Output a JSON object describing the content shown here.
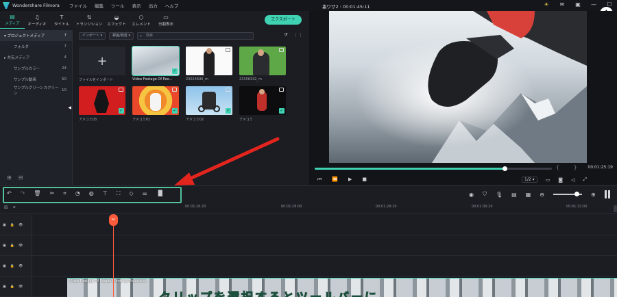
{
  "titlebar": {
    "app_name": "Wondershare Filmora",
    "menu": [
      "ファイル",
      "編集",
      "ツール",
      "表示",
      "出力",
      "ヘルプ"
    ],
    "doc_title": "裏ワザ2 : 00:01:45:11"
  },
  "media_tabs": [
    {
      "label": "メディア",
      "icon": "media-icon"
    },
    {
      "label": "オーディオ",
      "icon": "music-note-icon"
    },
    {
      "label": "タイトル",
      "icon": "text-t-icon"
    },
    {
      "label": "トランジション",
      "icon": "transition-icon"
    },
    {
      "label": "エフェクト",
      "icon": "effects-icon"
    },
    {
      "label": "エレメント",
      "icon": "elements-icon"
    },
    {
      "label": "分割表示",
      "icon": "split-screen-icon"
    }
  ],
  "export_label": "エクスポート",
  "sidebar": {
    "items": [
      {
        "label": "プロジェクトメディア",
        "count": "7"
      },
      {
        "label": "フォルダ",
        "count": "7"
      },
      {
        "label": "共有メディア",
        "count": "4"
      },
      {
        "label": "サンプルカラー",
        "count": "24"
      },
      {
        "label": "サンプル動画",
        "count": "50"
      },
      {
        "label": "サンプルグリーンスクリーン",
        "count": "10"
      }
    ]
  },
  "media_filters": {
    "import_label": "インポート",
    "record_label": "録画/録音",
    "search_placeholder": "検索"
  },
  "media_items": [
    {
      "caption": "ファイルをインポート"
    },
    {
      "caption": "Video Footage Of Peo..."
    },
    {
      "caption": "23024690_m"
    },
    {
      "caption": "23156332_m"
    },
    {
      "caption": "アメコミ03"
    },
    {
      "caption": "アメコミ01"
    },
    {
      "caption": "アメコミ02"
    },
    {
      "caption": "アメコミ"
    }
  ],
  "preview": {
    "progress": 0.8,
    "timecode": "00:01:25:19",
    "quality": "1/2"
  },
  "timeline": {
    "ruler_labels": [
      "00:01:26:20",
      "00:01:28:00",
      "00:01:29:10",
      "00:01:30:20",
      "00:01:32:00"
    ],
    "clip_title": "Video Footage Of People Climbing Mountains",
    "caption_overlay": "クリップを選択するとツールバーに"
  },
  "colors": {
    "accent": "#3fd2b3",
    "highlight_box": "#53c49a",
    "playhead": "#ff5a3c",
    "annotation_arrow": "#e3251d"
  }
}
